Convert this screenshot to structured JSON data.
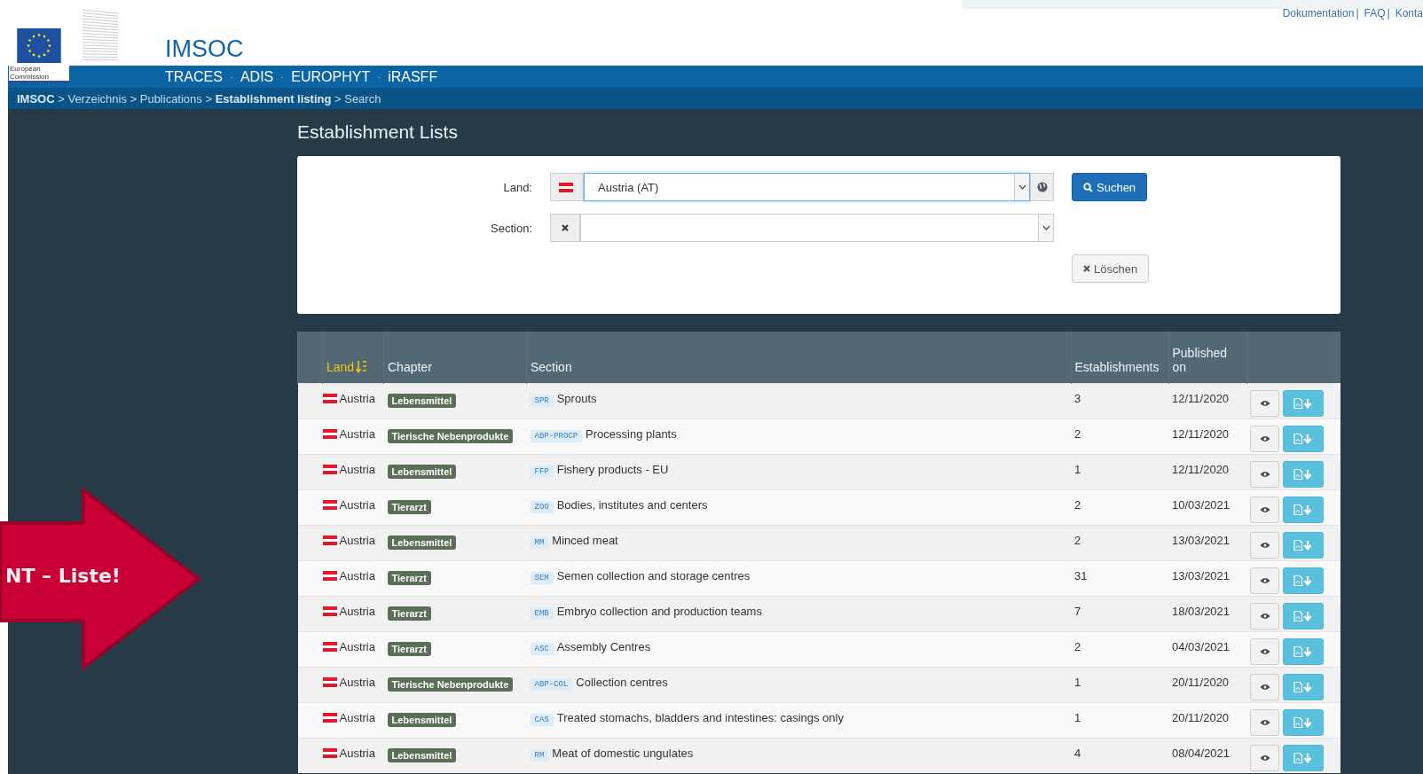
{
  "header": {
    "logo_text": [
      "European",
      "Commission"
    ],
    "top_links": {
      "items": [
        "Dokumentation",
        "FAQ",
        "Konta"
      ],
      "separator": "|"
    },
    "app_title": "IMSOC",
    "nav": {
      "items": [
        "TRACES",
        "ADIS",
        "EUROPHYT",
        "iRASFF"
      ],
      "separator": "·"
    },
    "breadcrumb": "**IMSOC** > Verzeichnis > Publications > **Establishment listing** > Search"
  },
  "page_title": "Establishment Lists",
  "search_form": {
    "land_label": "Land:",
    "land_value": "Austria (AT)",
    "section_label": "Section:",
    "search_button": "Suchen",
    "clear_button": "Löschen"
  },
  "table": {
    "columns": [
      {
        "label": "Land",
        "sorted": true
      },
      {
        "label": "Chapter",
        "sorted": false
      },
      {
        "label": "Section",
        "sorted": false
      },
      {
        "label": "Establishments",
        "sorted": false
      },
      {
        "label": "Published on",
        "sorted": false
      }
    ],
    "rows": [
      {
        "land": "Austria",
        "chapter": "Lebensmittel",
        "code": "SPR",
        "section": "Sprouts",
        "establishments": "3",
        "published": "12/11/2020"
      },
      {
        "land": "Austria",
        "chapter": "Tierische Nebenprodukte",
        "code": "ABP-PROCP",
        "section": "Processing plants",
        "establishments": "2",
        "published": "12/11/2020"
      },
      {
        "land": "Austria",
        "chapter": "Lebensmittel",
        "code": "FFP",
        "section": "Fishery products - EU",
        "establishments": "1",
        "published": "12/11/2020"
      },
      {
        "land": "Austria",
        "chapter": "Tierarzt",
        "code": "ZOO",
        "section": "Bodies, institutes and centers",
        "establishments": "2",
        "published": "10/03/2021"
      },
      {
        "land": "Austria",
        "chapter": "Lebensmittel",
        "code": "MM",
        "section": "Minced meat",
        "establishments": "2",
        "published": "13/03/2021"
      },
      {
        "land": "Austria",
        "chapter": "Tierarzt",
        "code": "SEM",
        "section": "Semen collection and storage centres",
        "establishments": "31",
        "published": "13/03/2021"
      },
      {
        "land": "Austria",
        "chapter": "Tierarzt",
        "code": "EMB",
        "section": "Embryo collection and production teams",
        "establishments": "7",
        "published": "18/03/2021"
      },
      {
        "land": "Austria",
        "chapter": "Tierarzt",
        "code": "ASC",
        "section": "Assembly Centres",
        "establishments": "2",
        "published": "04/03/2021"
      },
      {
        "land": "Austria",
        "chapter": "Tierische Nebenprodukte",
        "code": "ABP-COL",
        "section": "Collection centres",
        "establishments": "1",
        "published": "20/11/2020"
      },
      {
        "land": "Austria",
        "chapter": "Lebensmittel",
        "code": "CAS",
        "section": "Treated stomachs, bladders and intestines: casings only",
        "establishments": "1",
        "published": "20/11/2020"
      },
      {
        "land": "Austria",
        "chapter": "Lebensmittel",
        "code": "RM",
        "section": "Meat of domestic ungulates",
        "establishments": "4",
        "published": "08/04/2021"
      }
    ]
  },
  "annotation": {
    "text": "NT – Liste!"
  }
}
